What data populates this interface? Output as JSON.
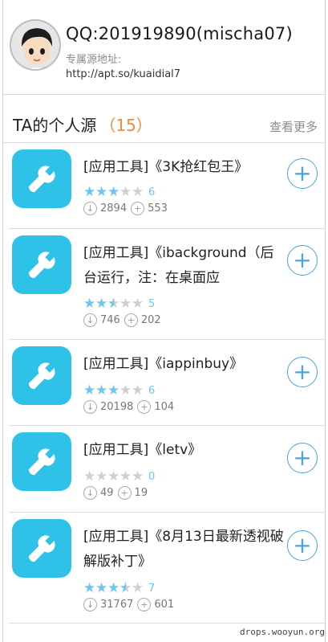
{
  "profile": {
    "qq": "QQ:201919890(mischa07)",
    "source_label": "专属源地址:",
    "source_url": "http://apt.so/kuaidial7"
  },
  "section": {
    "title": "TA的个人源",
    "count": "（15）",
    "more_label": "查看更多"
  },
  "apps": [
    {
      "name": "[应用工具]《3K抢红包王》",
      "rating": 3,
      "rating_count": "6",
      "downloads": "2894",
      "adds": "553",
      "icon": "wrench-icon"
    },
    {
      "name": "[应用工具]《ibackground（后台运行，注：在桌面应",
      "rating": 2.5,
      "rating_count": "5",
      "downloads": "746",
      "adds": "202",
      "icon": "wrench-icon"
    },
    {
      "name": "[应用工具]《iappinbuy》",
      "rating": 3,
      "rating_count": "6",
      "downloads": "20198",
      "adds": "104",
      "icon": "wrench-icon"
    },
    {
      "name": "[应用工具]《letv》",
      "rating": 0,
      "rating_count": "0",
      "downloads": "49",
      "adds": "19",
      "icon": "wrench-icon"
    },
    {
      "name": "[应用工具]《8月13日最新透视破解版补丁》",
      "rating": 3.5,
      "rating_count": "7",
      "downloads": "31767",
      "adds": "601",
      "icon": "wrench-icon"
    }
  ],
  "watermark": "drops.wooyun.org",
  "colors": {
    "accent": "#4aa3df",
    "icon_bg": "#2fc2e8",
    "star": "#6cc6ef",
    "count": "#f08a3c"
  }
}
